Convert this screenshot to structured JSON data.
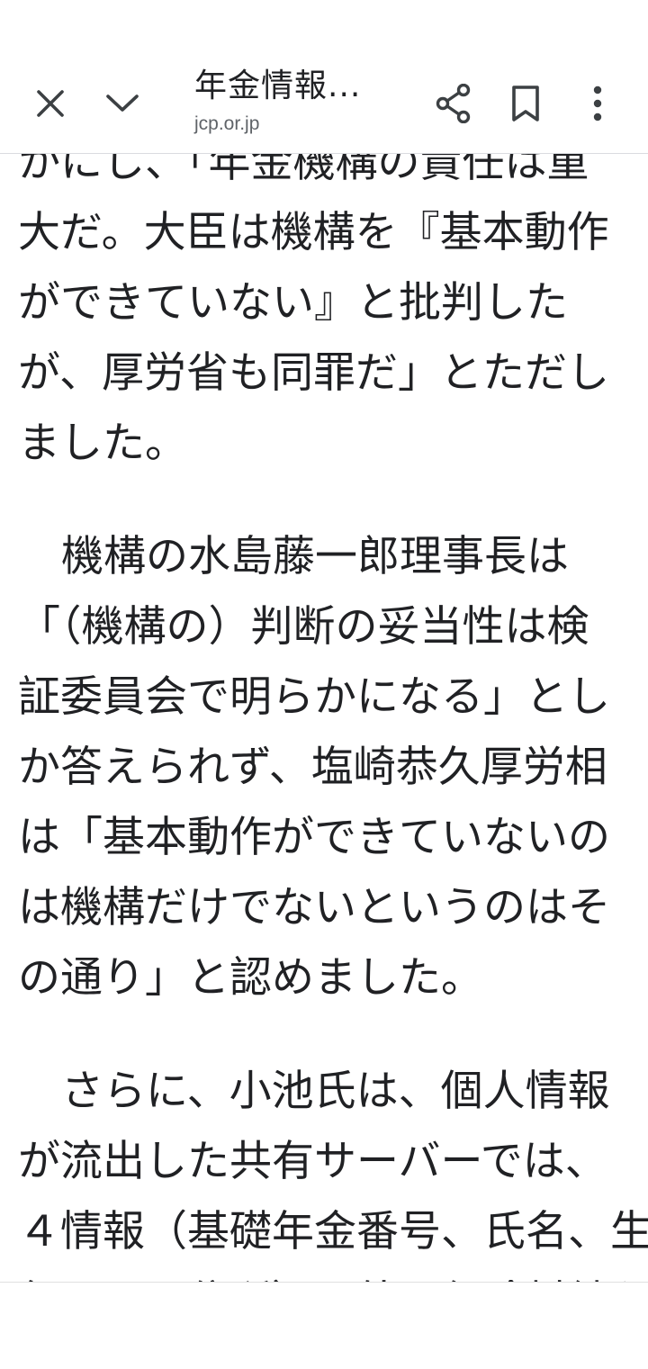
{
  "toolbar": {
    "title": "年金情報...",
    "domain": "jcp.or.jp",
    "icons": [
      "close-icon",
      "chevron-down-icon",
      "share-icon",
      "bookmark-icon",
      "more-vert-icon"
    ]
  },
  "article": {
    "paragraph1": [
      "かにし、「年金機構の責任は重",
      "大だ。大臣は機構を『基本動作",
      "ができていない』と批判した",
      "が、厚労省も同罪だ」とただし",
      "ました。"
    ],
    "paragraph2": [
      "機構の水島藤一郎理事長は",
      "「（機構の）判断の妥当性は検",
      "証委員会で明らかになる」とし",
      "か答えられず、塩崎恭久厚労相",
      "は「基本動作ができていないの",
      "は機構だけでないというのはそ",
      "の通り」と認めました。"
    ],
    "paragraph3": [
      "さらに、小池氏は、個人情報",
      "が流出した共有サーバーでは、",
      "４情報（基礎年金番号、氏名、生",
      "年月日、住所）以外に保険料納入"
    ]
  },
  "colors": {
    "text": "#202124",
    "secondary": "#5f6368",
    "icon": "#3c4043",
    "divider": "#dadce0"
  }
}
